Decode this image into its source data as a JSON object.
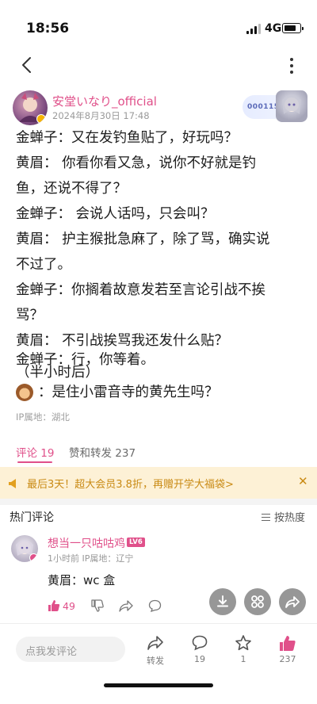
{
  "status_bar": {
    "time": "18:56",
    "network": "4G"
  },
  "post": {
    "author": "安堂いなり_official",
    "time": "2024年8月30日 17:48",
    "fan_badge": "000115",
    "lines": [
      "金蝉子：又在发钓鱼贴了，好玩吗？",
      "黄眉：  你看你看又急，说你不好就是钓",
      "鱼，还说不得了？",
      "金蝉子：  会说人话吗，只会叫？",
      "黄眉：  护主猴批急麻了，除了骂，确实说",
      "不过了。",
      "金蝉子：你搁着故意发若至言论引战不挨",
      "骂？",
      "黄眉：  不引战挨骂我还发什么贴？",
      "金蝉子：行，你等着。",
      "（半小时后）"
    ],
    "last_line": "：是住小雷音寺的黄先生吗？",
    "ip": "IP属地：湖北"
  },
  "tabs": {
    "comments": "评论 19",
    "reposts": "赞和转发 237"
  },
  "promo": {
    "text": "最后3天！超大会员3.8折，再赠开学大福袋>",
    "close": "✕"
  },
  "comments_header": {
    "title": "热门评论",
    "sort": "按热度"
  },
  "comment": {
    "name": "想当一只咕咕鸡",
    "level": "LV6",
    "meta": "1小时前  IP属地：辽宁",
    "text": "黄眉：wc 盒",
    "likes": "49"
  },
  "bottom_bar": {
    "placeholder": "点我发评论",
    "repost_label": "转发",
    "comment_count": "19",
    "fav_count": "1",
    "like_count": "237"
  },
  "colors": {
    "accent": "#e0508a",
    "promo_bg": "#fdf1d6",
    "promo_text": "#c98a14"
  }
}
